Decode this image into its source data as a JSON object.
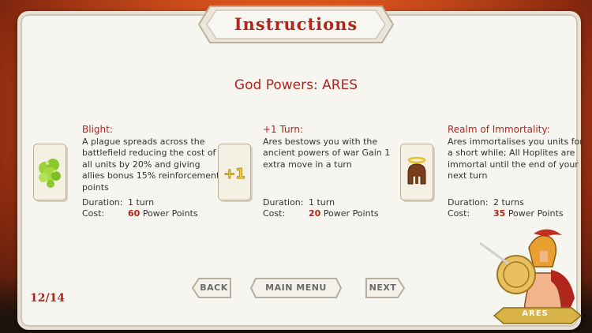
{
  "title": "Instructions",
  "subtitle": "God Powers: ARES",
  "powers": [
    {
      "name": "Blight:",
      "description": "A plague spreads across the battlefield reducing the cost of all units by 20% and giving allies bonus 15% reinforcement points",
      "duration_label": "Duration:",
      "duration_value": "1 turn",
      "cost_label": "Cost:",
      "cost_amount": "60",
      "cost_unit": "Power Points",
      "icon": "plague-cloud-icon"
    },
    {
      "name": "+1 Turn:",
      "description": "Ares bestows you with the ancient powers of war Gain 1 extra move in a turn",
      "duration_label": "Duration:",
      "duration_value": "1 turn",
      "cost_label": "Cost:",
      "cost_amount": "20",
      "cost_unit": "Power Points",
      "icon": "plus-one-icon",
      "icon_text": "+1"
    },
    {
      "name": "Realm of Immortality:",
      "description": "Ares immortalises you units for a short while; All Hoplites are immortal until the end of your next turn",
      "duration_label": "Duration:",
      "duration_value": "2 turns",
      "cost_label": "Cost:",
      "cost_amount": "35",
      "cost_unit": "Power Points",
      "icon": "haloed-helmet-icon"
    }
  ],
  "nav": {
    "back_label": "BACK",
    "main_menu_label": "MAIN MENU",
    "next_label": "NEXT"
  },
  "page_indicator": "12/14",
  "hero_label": "ARES",
  "colors": {
    "accent": "#b0261c",
    "panel": "#f7f5f0",
    "background": "#d8521c"
  }
}
